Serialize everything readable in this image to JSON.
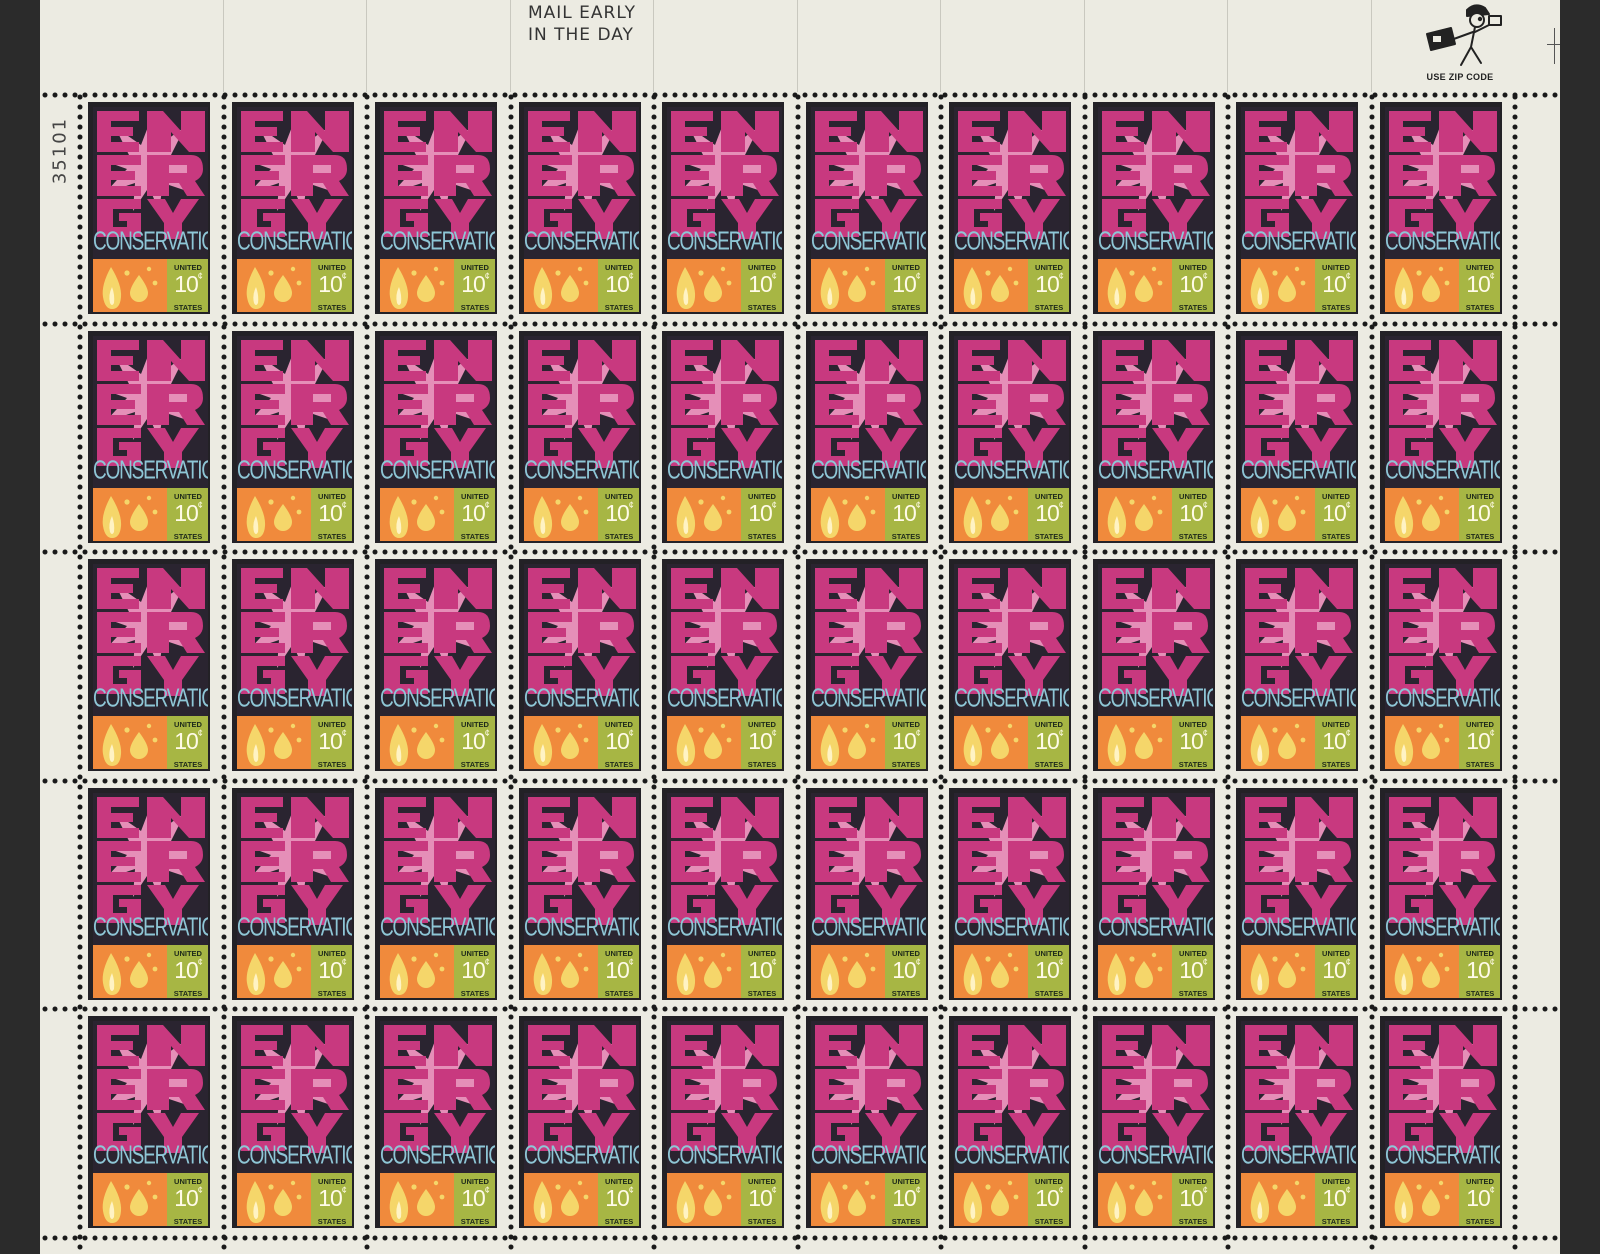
{
  "sheet": {
    "header_inscription": [
      "MAIL EARLY",
      "IN THE DAY"
    ],
    "plate_number": "35101",
    "mr_zip_label": "USE ZIP CODE"
  },
  "stamp": {
    "word_main": "ENERGY",
    "word_main_lines": [
      "EN",
      "ER",
      "GY"
    ],
    "subtitle": "CONSERVATION",
    "country_top": "UNITED",
    "country_bottom": "STATES",
    "denomination": "10",
    "denomination_unit": "¢"
  },
  "grid": {
    "rows": 5,
    "columns": 10
  },
  "colors": {
    "magenta": "#c8397f",
    "pink_burst": "#e58fb8",
    "dark_background": "#2a2430",
    "blue_text": "#8ec6d6",
    "orange_panel": "#f08a3c",
    "olive_panel": "#a7b644",
    "flame_yellow": "#f5d66a",
    "selvage": "#ecebe2"
  },
  "icons": [
    "flame-icon",
    "oil-drop-icon",
    "mr-zip-mascot-icon"
  ]
}
